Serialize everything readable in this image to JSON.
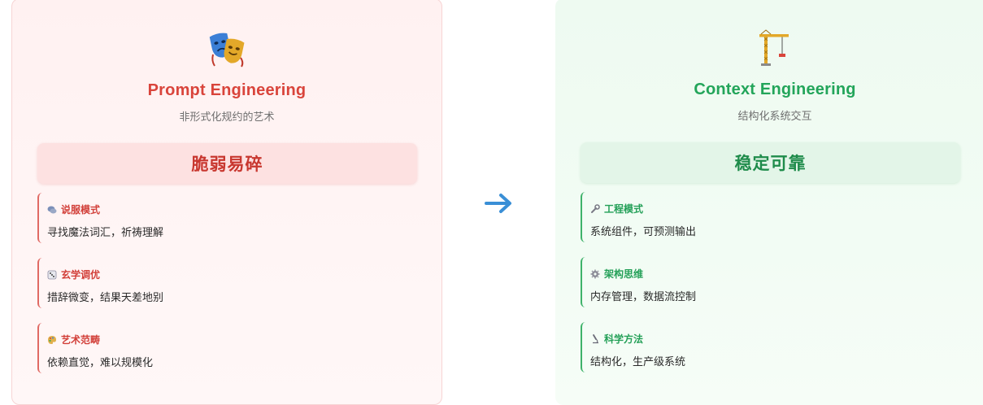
{
  "left": {
    "icon": "theater-masks-icon",
    "title": "Prompt Engineering",
    "subtitle": "非形式化规约的艺术",
    "badge": "脆弱易碎",
    "items": [
      {
        "icon": "speech-bubbles-icon",
        "label": "说服模式",
        "desc": "寻找魔法词汇，祈祷理解"
      },
      {
        "icon": "dice-icon",
        "label": "玄学调优",
        "desc": "措辞微变，结果天差地别"
      },
      {
        "icon": "palette-icon",
        "label": "艺术范畴",
        "desc": "依赖直觉，难以规模化"
      }
    ]
  },
  "arrow": {
    "icon": "right-arrow-icon"
  },
  "right": {
    "icon": "construction-crane-icon",
    "title": "Context Engineering",
    "subtitle": "结构化系统交互",
    "badge": "稳定可靠",
    "items": [
      {
        "icon": "wrench-icon",
        "label": "工程模式",
        "desc": "系统组件，可预测输出"
      },
      {
        "icon": "gear-icon",
        "label": "架构思维",
        "desc": "内存管理，数据流控制"
      },
      {
        "icon": "microscope-icon",
        "label": "科学方法",
        "desc": "结构化，生产级系统"
      }
    ]
  },
  "colors": {
    "left_accent": "#d9443b",
    "right_accent": "#23a55a",
    "arrow": "#3a8fd6"
  }
}
